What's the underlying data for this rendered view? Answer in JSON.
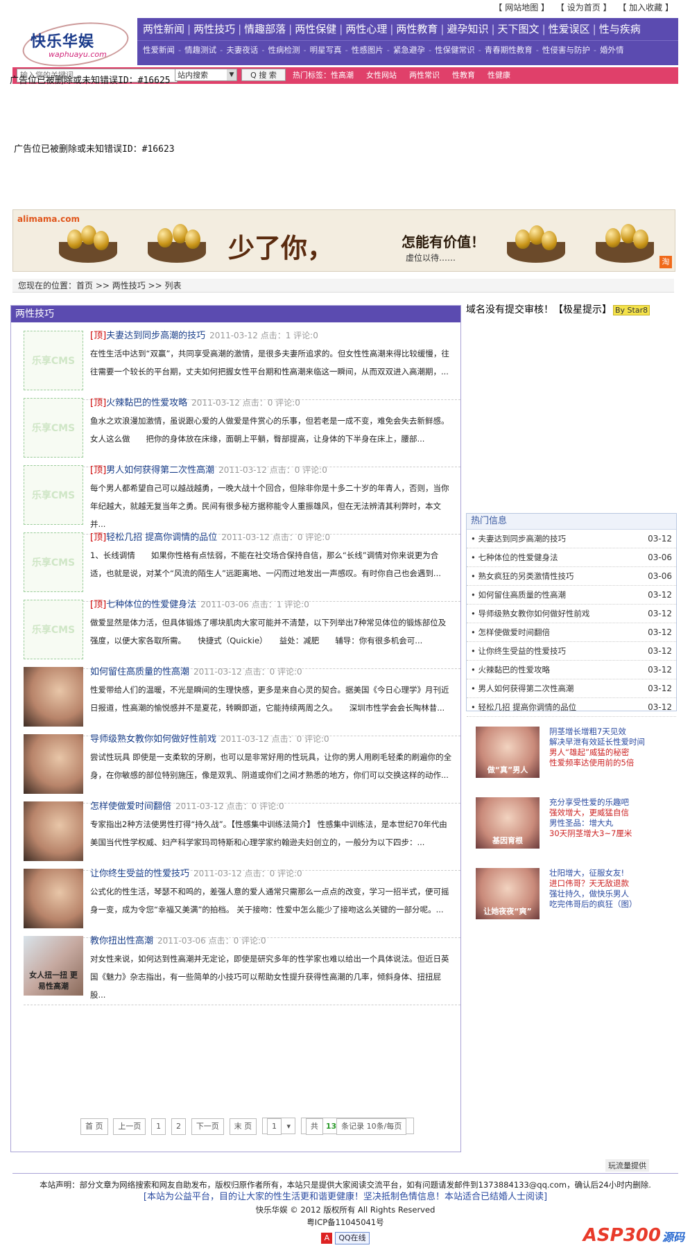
{
  "topbar": {
    "sitemap": "【 网站地图 】",
    "sethome": "【 设为首页 】",
    "fav": "【 加入收藏 】"
  },
  "logo": {
    "cn": "快乐华娱",
    "en": "waphuayu.com"
  },
  "nav": {
    "primary": [
      "两性新闻",
      "两性技巧",
      "情趣部落",
      "两性保健",
      "两性心理",
      "两性教育",
      "避孕知识",
      "天下图文",
      "性爱误区",
      "性与疾病"
    ],
    "secondary": [
      "性爱新闻",
      "情趣测试",
      "夫妻夜话",
      "性病检测",
      "明星写真",
      "性感图片",
      "紧急避孕",
      "性保健常识",
      "青春期性教育",
      "性侵害与防护",
      "婚外情"
    ]
  },
  "search": {
    "placeholder": "输入您的关键词...",
    "scope": "站内搜索",
    "button": "Q 搜 索",
    "hot_label": "热门标签：",
    "hot": [
      "性高潮",
      "女性网站",
      "两性常识",
      "性教育",
      "性健康"
    ]
  },
  "ads": {
    "error1": "广告位已被删除或未知错误ID：#16625",
    "error2": "广告位已被删除或未知错误ID：#16623"
  },
  "banner": {
    "brand": "alimama.com",
    "slogan": "少了你，",
    "slogan2": "怎能有价值！",
    "sub": "虚位以待……",
    "tao": "淘"
  },
  "crumb": "您现在的位置：首页 >> 两性技巧 >> 列表",
  "main": {
    "title": "两性技巧",
    "items": [
      {
        "top": true,
        "title": "夫妻达到同步高潮的技巧",
        "meta": "2011-03-12 点击：1 评论:0",
        "desc": "在性生活中达到“双赢”，共同享受高潮的激情，是很多夫妻所追求的。但女性性高潮来得比较缓慢，往往需要一个较长的平台期，丈夫如何把握女性平台期和性高潮来临这一瞬间，从而双双进入高潮期，...",
        "thumb": "乐享CMS"
      },
      {
        "top": true,
        "title": "火辣黏巴的性爱攻略",
        "meta": "2011-03-12 点击：0 评论:0",
        "desc": "鱼水之欢浪漫加激情，虽说跟心爱的人做爱是件赏心的乐事，但若老是一成不变，难免会失去新鲜感。　　女人这么做　　把你的身体放在床缘，面朝上平躺，臀部提高，让身体的下半身在床上，腰部...",
        "thumb": "乐享CMS"
      },
      {
        "top": true,
        "title": "男人如何获得第二次性高潮",
        "meta": "2011-03-12 点击：0 评论:0",
        "desc": "每个男人都希望自己可以越战越勇，一晚大战十个回合，但除非你是十多二十岁的年青人，否则，当你年纪越大，就越无复当年之勇。民间有很多秘方据称能令人重振雄风，但在无法辨清其利弊时，本文并...",
        "thumb": "乐享CMS"
      },
      {
        "top": true,
        "title": "轻松几招 提高你调情的品位",
        "meta": "2011-03-12 点击：0 评论:0",
        "desc": "1、长线调情　　如果你性格有点怯弱，不能在社交场合保持自信，那么“长线”调情对你来说更为合适，也就是说，对某个“风流的陌生人”远距离地、一闪而过地发出一声感叹。有时你自己也会遇到...",
        "thumb": "乐享CMS"
      },
      {
        "top": true,
        "title": "七种体位的性爱健身法",
        "meta": "2011-03-06 点击：1 评论:0",
        "desc": "做爱显然是体力活，但具体锻炼了哪块肌肉大家可能并不清楚，以下列举出7种常见体位的锻炼部位及强度，以便大家各取所需。　　快捷式（Quickie）　　益处：减肥　　辅导：你有很多机会可...",
        "thumb": "乐享CMS"
      },
      {
        "top": false,
        "title": "如何留住高质量的性高潮",
        "meta": "2011-03-12 点击：0 评论:0",
        "desc": "性爱带给人们的温暖，不光是瞬间的生理快感，更多是来自心灵的契合。据美国《今日心理学》月刊近日报道，性高潮的愉悦感并不是夏花，转瞬即逝，它能持续两周之久。　　深圳市性学会会长陶林昔...",
        "thumb": ""
      },
      {
        "top": false,
        "title": "导师级熟女教你如何做好性前戏",
        "meta": "2011-03-12 点击：0 评论:0",
        "desc": "尝试性玩具 即使是一支柔软的牙刷，也可以是非常好用的性玩具，让你的男人用刷毛轻柔的刷遍你的全身，在你敏感的部位特别施压，像是双乳、阴道或你们之间才熟悉的地方，你们可以交换这样的动作...",
        "thumb": ""
      },
      {
        "top": false,
        "title": "怎样使做爱时间翻倍",
        "meta": "2011-03-12 点击：0 评论:0",
        "desc": "专家指出2种方法使男性打得“持久战”。【性感集中训练法简介】 性感集中训练法，是本世纪70年代由美国当代性学权威、妇产科学家玛司特斯和心理学家约翰逊夫妇创立的，一般分为以下四步：...",
        "thumb": ""
      },
      {
        "top": false,
        "title": "让你终生受益的性爱技巧",
        "meta": "2011-03-12 点击：0 评论:0",
        "desc": "公式化的性生活，琴瑟不和鸣的，差强人意的爱人通常只需那么一点点的改变，学习一招半式，便可摇身一变，成为令您“幸福又美满”的拍档。 关于接吻：性爱中怎么能少了接吻这么关键的一部分呢。...",
        "thumb": ""
      },
      {
        "top": false,
        "title": "教你扭出性高潮",
        "meta": "2011-03-06 点击：0 评论:0",
        "desc": "对女性来说，如何达到性高潮并无定论，即使是研究多年的性学家也难以给出一个具体说法。但近日英国《魅力》杂志指出，有一些简单的小技巧可以帮助女性提升获得性高潮的几率，倾斜身体、扭扭屁股...",
        "thumb": "女人扭一扭 更易性高潮"
      }
    ],
    "top_tag": "[顶]"
  },
  "pager": {
    "first": "首 页",
    "prev": "上一页",
    "p1": "1",
    "p2": "2",
    "next": "下一页",
    "last": "末 页",
    "select": "1",
    "total_pre": "共",
    "total_num": "13",
    "total_post": "条记录 10条/每页"
  },
  "side": {
    "notice": "域名没有提交审核！【极星提示】",
    "tag": "By Star8"
  },
  "hot": {
    "title": "热门信息",
    "rows": [
      {
        "t": "• 夫妻达到同步高潮的技巧",
        "d": "03-12"
      },
      {
        "t": "• 七种体位的性爱健身法",
        "d": "03-06"
      },
      {
        "t": "• 熟女疯狂的另类激情性技巧",
        "d": "03-06"
      },
      {
        "t": "• 如何留住高质量的性高潮",
        "d": "03-12"
      },
      {
        "t": "• 导师级熟女教你如何做好性前戏",
        "d": "03-12"
      },
      {
        "t": "• 怎样使做爱时间翻倍",
        "d": "03-12"
      },
      {
        "t": "• 让你终生受益的性爱技巧",
        "d": "03-12"
      },
      {
        "t": "• 火辣黏巴的性爱攻略",
        "d": "03-12"
      },
      {
        "t": "• 男人如何获得第二次性高潮",
        "d": "03-12"
      },
      {
        "t": "• 轻松几招 提高你调情的品位",
        "d": "03-12"
      }
    ]
  },
  "promos": [
    {
      "img": "做“真”男人",
      "l1": "阴茎增长增粗7天见效",
      "l2": "解决早泄有效延长性爱时间",
      "l3": "男人“雄起”威猛的秘密",
      "l4": "性爱频率达使用前的5倍"
    },
    {
      "img": "基因育根",
      "l1": "充分享受性爱的乐趣吧",
      "l2": "强效增大，更威猛自信",
      "l3": "男性圣品：增大丸",
      "l4": "30天阴茎增大3~7厘米"
    },
    {
      "img": "让她夜夜“爽”",
      "l1": "壮阳增大，征服女友!",
      "l2": "进口伟哥？天无敌退款",
      "l3": "强壮持久，做快乐男人",
      "l4": "吃完伟哥后的疯狂（图）"
    }
  ],
  "provided": "玩流量提供",
  "footer": {
    "l1": "本站声明：部分文章为网络搜索和网友自助发布，版权归原作者所有，本站只是提供大家阅读交流平台，如有问题请发邮件到1373884133@qq.com，确认后24小时内删除.",
    "l2": "[本站为公益平台，目的让大家的性生活更和谐更健康！坚决抵制色情信息！本站适合已结婚人士阅读]",
    "l3": "快乐华娱 © 2012 版权所有 All Rights Reserved",
    "l4": "粤ICP备11045041号",
    "qq": "QQ在线",
    "a": "A",
    "asp": "ASP300",
    "asp_cn": "源码"
  }
}
